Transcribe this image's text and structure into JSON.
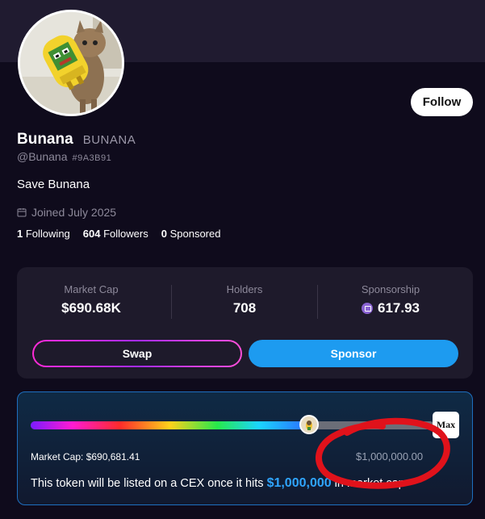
{
  "profile": {
    "name": "Bunana",
    "ticker": "BUNANA",
    "handle": "@Bunana",
    "hash": "#9A3B91",
    "bio": "Save Bunana",
    "joined": "Joined July 2025",
    "following_count": "1",
    "following_label": "Following",
    "followers_count": "604",
    "followers_label": "Followers",
    "sponsored_count": "0",
    "sponsored_label": "Sponsored",
    "follow_label": "Follow"
  },
  "metrics": {
    "market_cap_label": "Market Cap",
    "market_cap_value": "$690.68K",
    "holders_label": "Holders",
    "holders_value": "708",
    "sponsorship_label": "Sponsorship",
    "sponsorship_value": "617.93"
  },
  "actions": {
    "swap_label": "Swap",
    "sponsor_label": "Sponsor"
  },
  "progress": {
    "fraction": 0.6907,
    "badge_text": "Max",
    "market_cap_text": "Market Cap: $690,681.41",
    "target_text": "$1,000,000.00",
    "cex_prefix": "This token will be listed on a CEX once it hits",
    "cex_amount": "$1,000,000",
    "cex_suffix": "in market cap"
  },
  "colors": {
    "background": "#0f0b1c",
    "card": "#1e1a2b",
    "accent_blue": "#1d9bf0",
    "annotation_red": "#e0121b"
  },
  "icons": {
    "calendar": "calendar-icon",
    "sponsorship": "sponsorship-coin-icon",
    "progress_thumb": "token-avatar-icon"
  }
}
